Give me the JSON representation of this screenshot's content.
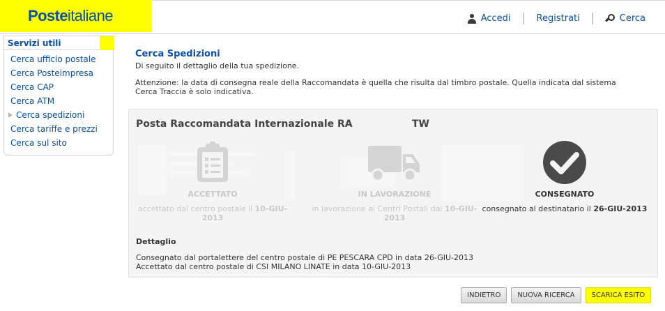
{
  "header": {
    "logo_bold": "Poste",
    "logo_light": "italiane",
    "nav": {
      "login": "Accedi",
      "register": "Registrati",
      "search": "Cerca"
    }
  },
  "sidebar": {
    "title": "Servizi utili",
    "items": [
      {
        "label": "Cerca ufficio postale"
      },
      {
        "label": "Cerca Posteimpresa"
      },
      {
        "label": "Cerca CAP"
      },
      {
        "label": "Cerca ATM"
      },
      {
        "label": "Cerca spedizioni"
      },
      {
        "label": "Cerca tariffe e prezzi"
      },
      {
        "label": "Cerca sul sito"
      }
    ]
  },
  "main": {
    "title": "Cerca Spedizioni",
    "subtitle": "Di seguito il dettaglio della tua spedizione.",
    "notice_line1": "Attenzione: la data di consegna reale della Raccomandata è quella che risulta dal timbro postale. Quella indicata dal sistema",
    "notice_line2": "Cerca Traccia è solo indicativa."
  },
  "shipment": {
    "type": "Posta Raccomandata Internazionale RA",
    "code_suffix": "TW",
    "steps": [
      {
        "icon": "clipboard-icon",
        "label": "ACCETTATO",
        "desc": "accettato dal centro postale il ",
        "date": "10-GIU-2013",
        "active": false
      },
      {
        "icon": "truck-icon",
        "label": "IN LAVORAZIONE",
        "desc": "in lavorazione ai Centri Postali dal ",
        "date": "10-GIU-2013",
        "active": false
      },
      {
        "icon": "check-circle-icon",
        "label": "CONSEGNATO",
        "desc": "consegnato al destinatario il ",
        "date": "26-GIU-2013",
        "active": true
      }
    ],
    "detail_title": "Dettaglio",
    "detail_lines": [
      "Consegnato dal portalettere del centro postale di PE PESCARA CPD in data 26-GIU-2013",
      "Accettato dal centro postale di CSI MILANO LINATE in data 10-GIU-2013"
    ]
  },
  "actions": {
    "back": "INDIETRO",
    "new_search": "NUOVA RICERCA",
    "download": "SCARICA ESITO"
  },
  "colors": {
    "brand_blue": "#0a4fa8",
    "highlight_yellow": "#ffff00",
    "inactive_gray": "#c8c8c8",
    "active_dark": "#4a4a4a"
  }
}
